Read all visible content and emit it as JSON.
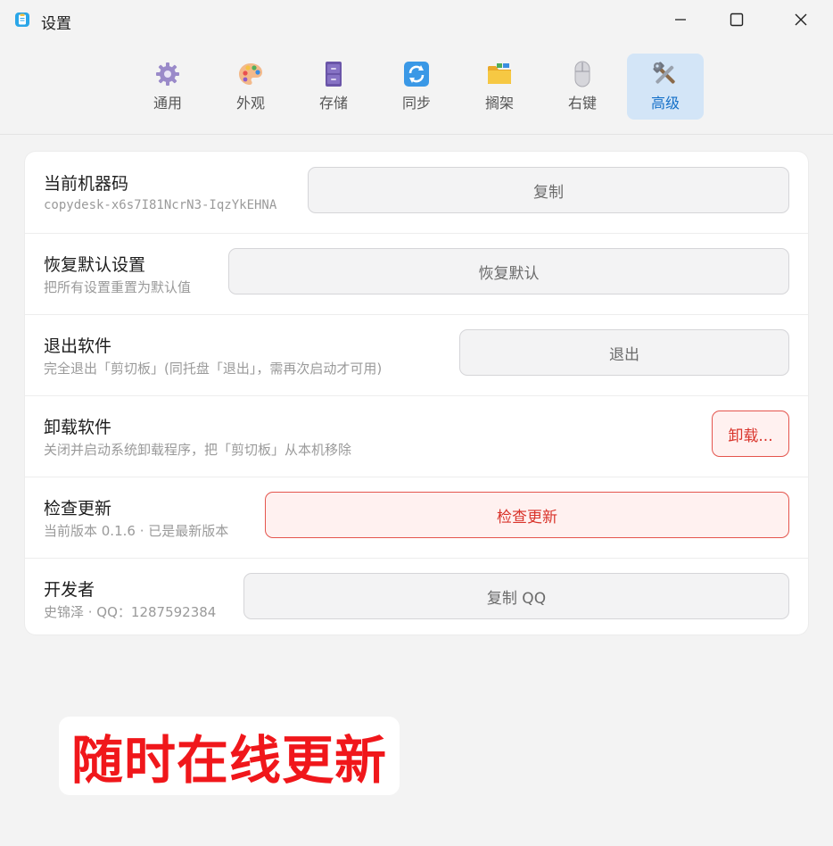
{
  "window": {
    "title": "设置",
    "icon": "clipboard-app-icon"
  },
  "tabs": [
    {
      "label": "通用",
      "icon": "gear-icon",
      "active": false
    },
    {
      "label": "外观",
      "icon": "palette-icon",
      "active": false
    },
    {
      "label": "存储",
      "icon": "cabinet-icon",
      "active": false
    },
    {
      "label": "同步",
      "icon": "sync-icon",
      "active": false
    },
    {
      "label": "搁架",
      "icon": "folder-icon",
      "active": false
    },
    {
      "label": "右键",
      "icon": "mouse-icon",
      "active": false
    },
    {
      "label": "高级",
      "icon": "tools-icon",
      "active": true
    }
  ],
  "rows": [
    {
      "title": "当前机器码",
      "desc": "copydesk-x6s7I81NcrN3-IqzYkEHNA",
      "button": "复制",
      "danger": false
    },
    {
      "title": "恢复默认设置",
      "desc": "把所有设置重置为默认值",
      "button": "恢复默认",
      "danger": false
    },
    {
      "title": "退出软件",
      "desc": "完全退出「剪切板」(同托盘「退出」，需再次启动才可用)",
      "button": "退出",
      "danger": false
    },
    {
      "title": "卸载软件",
      "desc": "关闭并启动系统卸载程序，把「剪切板」从本机移除",
      "button": "卸载...",
      "danger": true
    },
    {
      "title": "检查更新",
      "desc": "当前版本 0.1.6 · 已是最新版本",
      "button": "检查更新",
      "danger": true
    },
    {
      "title": "开发者",
      "desc": "史锦泽 · QQ：1287592384",
      "button": "复制 QQ",
      "danger": false
    }
  ],
  "promo": {
    "text": "随时在线更新"
  },
  "colors": {
    "accent": "#1570c8",
    "active_tab_bg": "#d3e5f7",
    "danger": "#d9342b",
    "danger_bg": "#fff1f0",
    "promo_text": "#f0171b"
  }
}
